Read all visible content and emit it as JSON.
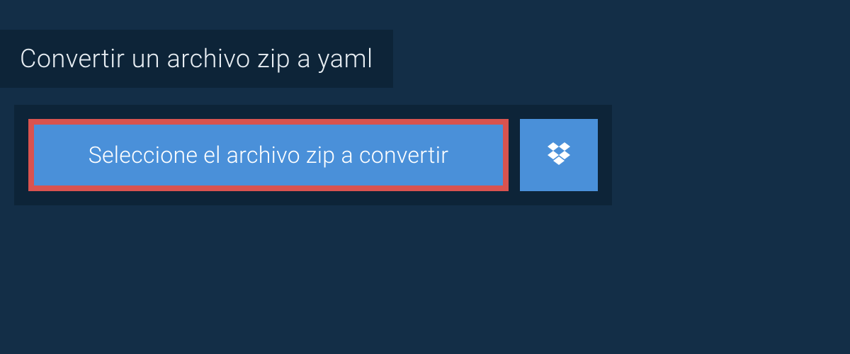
{
  "header": {
    "title": "Convertir un archivo zip a yaml"
  },
  "actions": {
    "select_file_label": "Seleccione el archivo zip a convertir",
    "dropbox_icon": "dropbox-icon"
  },
  "colors": {
    "page_bg": "#132e47",
    "panel_bg": "#0d2438",
    "button_bg": "#4a90d9",
    "highlight_border": "#d9534f",
    "text_light": "#e8eef3"
  }
}
